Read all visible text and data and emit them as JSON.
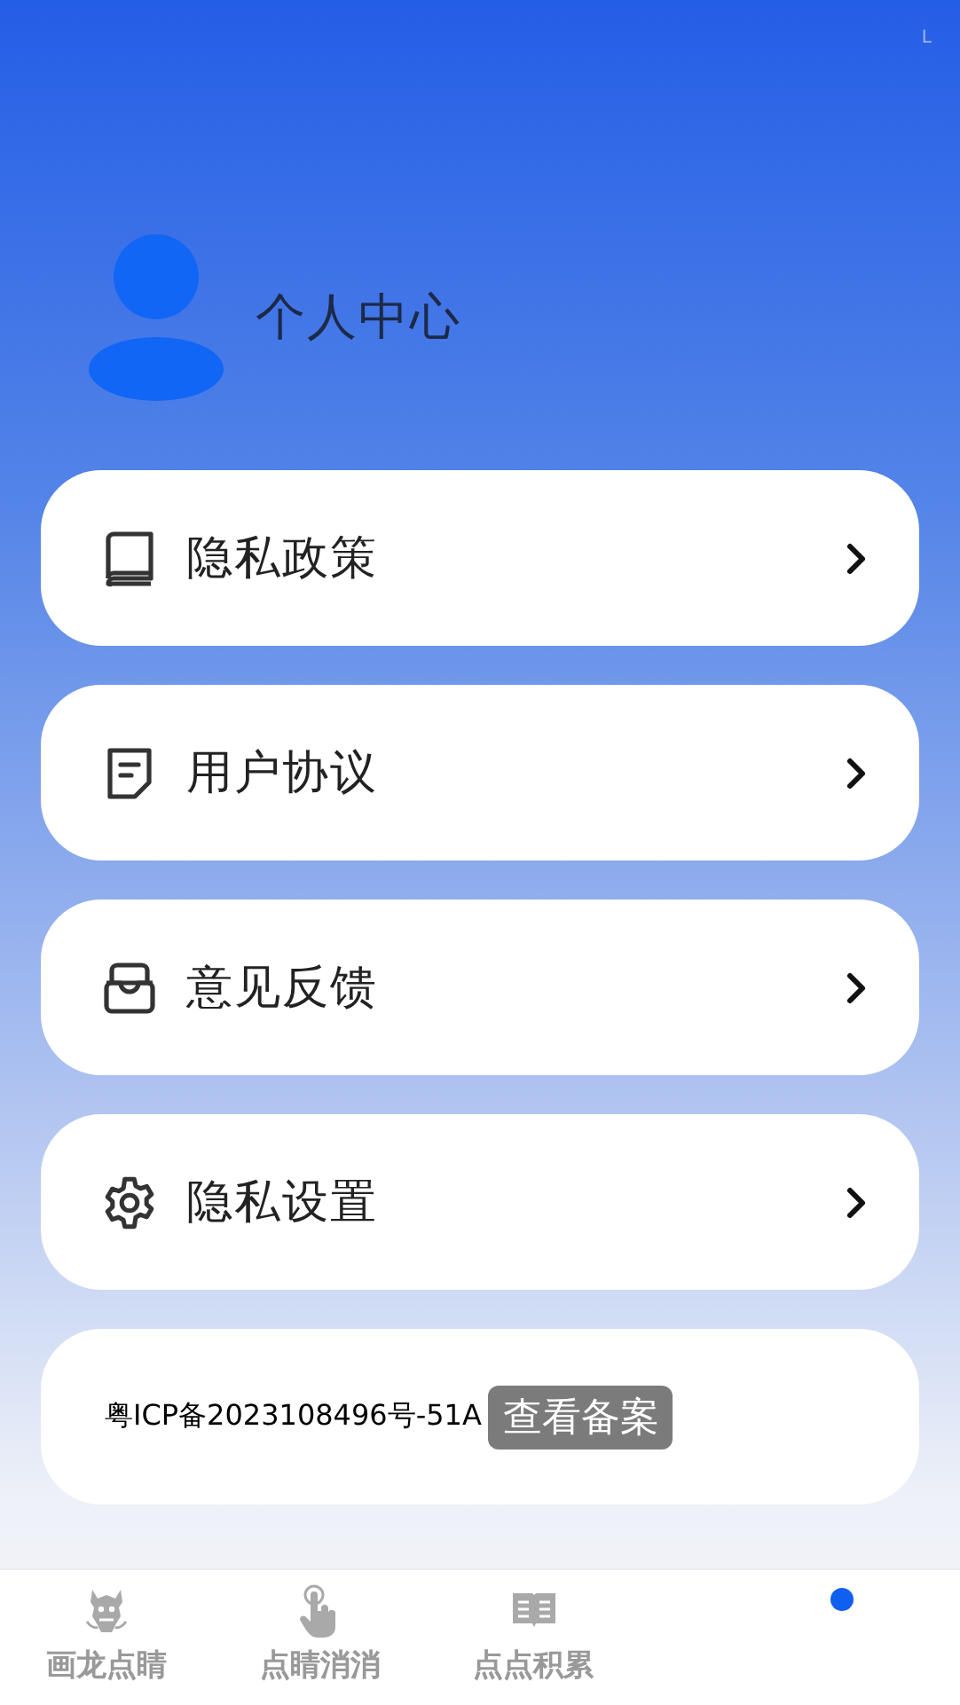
{
  "status_bar": {
    "indicator": "L"
  },
  "profile": {
    "title": "个人中心"
  },
  "menu": [
    {
      "label": "隐私政策"
    },
    {
      "label": "用户协议"
    },
    {
      "label": "意见反馈"
    },
    {
      "label": "隐私设置"
    }
  ],
  "icp": {
    "text": "粤ICP备2023108496号-51A",
    "button": "查看备案"
  },
  "tabs": [
    {
      "label": "画龙点睛",
      "selected": false
    },
    {
      "label": "点睛消消",
      "selected": false
    },
    {
      "label": "点点积累",
      "selected": false
    },
    {
      "selected": true
    }
  ]
}
